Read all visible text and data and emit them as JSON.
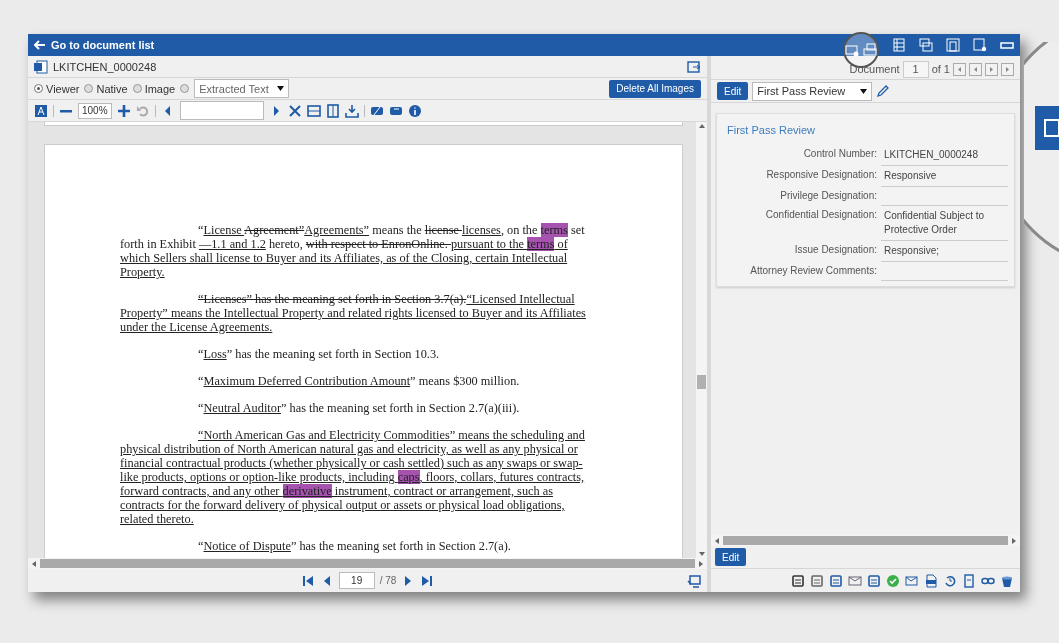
{
  "top_bar": {
    "back_label": "Go to document list"
  },
  "viewer": {
    "file_name": "LKITCHEN_0000248",
    "modes": [
      {
        "label": "Viewer",
        "selected": true
      },
      {
        "label": "Native",
        "selected": false
      },
      {
        "label": "Image",
        "selected": false
      },
      {
        "selected": false
      }
    ],
    "text_source": "Extracted Text",
    "delete_button": "Delete All Images",
    "zoom": "100%",
    "paragraphs": [
      {
        "indent": true,
        "segments": [
          {
            "kind": "plain",
            "text": "“"
          },
          {
            "kind": "ins",
            "text": "License "
          },
          {
            "kind": "del",
            "text": "Agreement”"
          },
          {
            "kind": "ins",
            "text": "Agreements”"
          },
          {
            "kind": "plain",
            "text": " means the "
          },
          {
            "kind": "del",
            "text": "license "
          },
          {
            "kind": "ins",
            "text": "licenses"
          },
          {
            "kind": "plain",
            "text": ", on the "
          },
          {
            "kind": "hit",
            "text": "terms"
          },
          {
            "kind": "plain",
            "text": " set forth in Exhibit "
          },
          {
            "kind": "ins",
            "text": "—1.1 and 1.2"
          },
          {
            "kind": "plain",
            "text": " hereto, "
          },
          {
            "kind": "del",
            "text": "with respect to EnronOnline. "
          },
          {
            "kind": "ins",
            "text": "pursuant to the "
          },
          {
            "kind": "ins-hit",
            "text": "terms"
          },
          {
            "kind": "ins",
            "text": " of which Sellers shall license to Buyer and its Affiliates, as of the Closing, certain Intellectual Property."
          }
        ]
      },
      {
        "indent": true,
        "segments": [
          {
            "kind": "del",
            "text": "“Licenses” has the meaning set forth in Section 3.7(a)."
          },
          {
            "kind": "ins",
            "text": "“Licensed Intellectual Property” means the Intellectual Property and related rights licensed to Buyer and its Affiliates under the License Agreements."
          }
        ]
      },
      {
        "indent": true,
        "segments": [
          {
            "kind": "plain",
            "text": "“"
          },
          {
            "kind": "ins",
            "text": "Loss"
          },
          {
            "kind": "plain",
            "text": "” has the meaning set forth in Section 10.3."
          }
        ]
      },
      {
        "indent": true,
        "segments": [
          {
            "kind": "plain",
            "text": "“"
          },
          {
            "kind": "ins",
            "text": "Maximum Deferred Contribution Amount"
          },
          {
            "kind": "plain",
            "text": "” means $300 million."
          }
        ]
      },
      {
        "indent": true,
        "segments": [
          {
            "kind": "plain",
            "text": "“"
          },
          {
            "kind": "ins",
            "text": "Neutral Auditor"
          },
          {
            "kind": "plain",
            "text": "” has the meaning set forth in Section 2.7(a)(iii)."
          }
        ]
      },
      {
        "indent": true,
        "segments": [
          {
            "kind": "ins",
            "text": "“North American Gas and Electricity Commodities” means the scheduling and physical distribution of North American natural gas and electricity, as well as any physical or financial contractual products (whether physically or cash settled) such as any swaps or swap-like products, options or option-like products, including "
          },
          {
            "kind": "ins-hit",
            "text": "caps"
          },
          {
            "kind": "ins",
            "text": ", floors, collars, futures contracts, forward contracts, and any other "
          },
          {
            "kind": "ins-hit",
            "text": "derivative"
          },
          {
            "kind": "ins",
            "text": " instrument, contract or arrangement, such as contracts for the forward delivery of physical output or assets or physical load obligations, related thereto."
          }
        ]
      },
      {
        "indent": true,
        "segments": [
          {
            "kind": "plain",
            "text": "“"
          },
          {
            "kind": "ins",
            "text": "Notice of Dispute"
          },
          {
            "kind": "plain",
            "text": "” has the meaning set forth in Section 2.7(a)."
          }
        ]
      }
    ],
    "page": "19",
    "page_total": "/ 78"
  },
  "review": {
    "document_label": "Document",
    "document_value": "1",
    "document_total": "of 1",
    "edit_button": "Edit",
    "layout": "First Pass Review",
    "panel_title": "First Pass Review",
    "fields": [
      {
        "label": "Control Number:",
        "value": "LKITCHEN_0000248"
      },
      {
        "label": "Responsive Designation:",
        "value": "Responsive"
      },
      {
        "label": "Privilege Designation:"
      },
      {
        "label": "Confidential Designation:",
        "value": "Confidential Subject to Protective Order"
      },
      {
        "label": "Issue Designation:",
        "value": "Responsive;"
      },
      {
        "label": "Attorney Review Comments:"
      }
    ],
    "bottom_edit": "Edit"
  }
}
